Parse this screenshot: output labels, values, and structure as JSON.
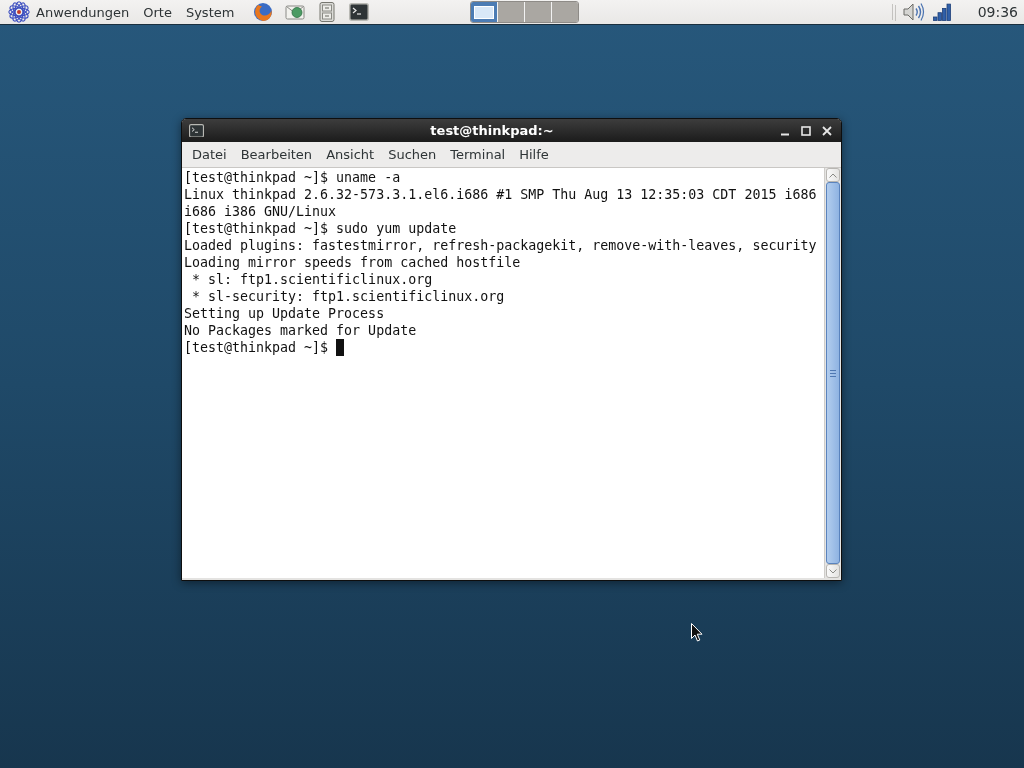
{
  "top_panel": {
    "menus": [
      "Anwendungen",
      "Orte",
      "System"
    ],
    "workspaces": [
      {
        "selected": true,
        "has_window": true
      },
      {
        "selected": false,
        "has_window": false
      },
      {
        "selected": false,
        "has_window": false
      },
      {
        "selected": false,
        "has_window": false
      }
    ],
    "clock": "09:36"
  },
  "window": {
    "title": "test@thinkpad:~",
    "menu": [
      "Datei",
      "Bearbeiten",
      "Ansicht",
      "Suchen",
      "Terminal",
      "Hilfe"
    ],
    "terminal": {
      "lines": [
        "[test@thinkpad ~]$ uname -a",
        "Linux thinkpad 2.6.32-573.3.1.el6.i686 #1 SMP Thu Aug 13 12:35:03 CDT 2015 i686",
        "i686 i386 GNU/Linux",
        "[test@thinkpad ~]$ sudo yum update",
        "Loaded plugins: fastestmirror, refresh-packagekit, remove-with-leaves, security",
        "Loading mirror speeds from cached hostfile",
        " * sl: ftp1.scientificlinux.org",
        " * sl-security: ftp1.scientificlinux.org",
        "Setting up Update Process",
        "No Packages marked for Update",
        "[test@thinkpad ~]$"
      ],
      "cursor": true
    }
  }
}
